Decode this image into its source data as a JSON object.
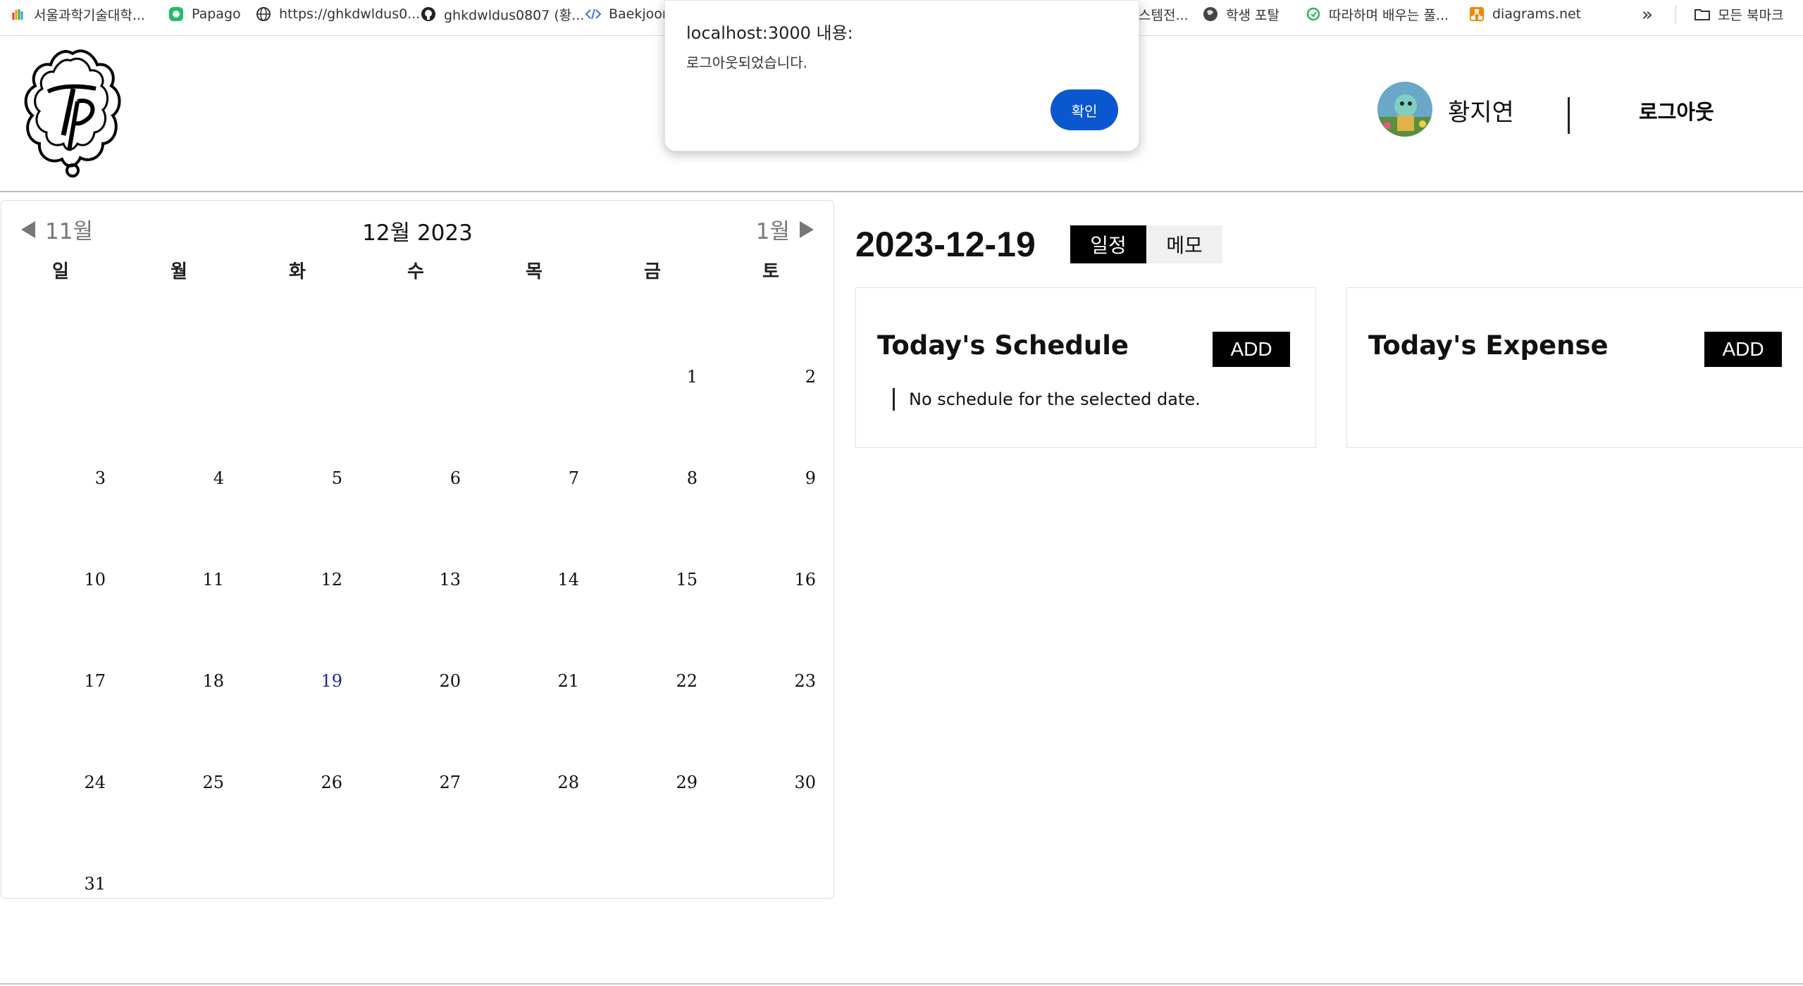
{
  "bookmarks": [
    {
      "label": "서울과학기술대학...",
      "icon": "rainbow-hand-icon"
    },
    {
      "label": "Papago",
      "icon": "papago-icon"
    },
    {
      "label": "https://ghkdwldus0...",
      "icon": "globe-icon"
    },
    {
      "label": "ghkdwldus0807 (황...",
      "icon": "github-icon"
    },
    {
      "label": "Baekjoon",
      "icon": "code-icon"
    },
    {
      "label": "스템전...",
      "icon": ""
    },
    {
      "label": "학생 포탈",
      "icon": "globe-dark-icon"
    },
    {
      "label": "따라하며 배우는 풀...",
      "icon": "inflearn-icon"
    },
    {
      "label": "diagrams.net",
      "icon": "diagrams-icon"
    },
    {
      "label": "모든 북마크",
      "icon": "folder-icon"
    }
  ],
  "bookmarks_more": "»",
  "header": {
    "username": "황지연",
    "logout_label": "로그아웃"
  },
  "dialog": {
    "title": "localhost:3000 내용:",
    "message": "로그아웃되었습니다.",
    "ok_label": "확인"
  },
  "calendar": {
    "title": "12월 2023",
    "prev_label": "11월",
    "next_label": "1월",
    "weekdays": [
      "일",
      "월",
      "화",
      "수",
      "목",
      "금",
      "토"
    ],
    "first_weekday_index": 5,
    "days_in_month": 31,
    "selected_day": 19
  },
  "detail": {
    "date": "2023-12-19",
    "tabs": [
      {
        "label": "일정",
        "active": true
      },
      {
        "label": "메모",
        "active": false
      }
    ],
    "schedule": {
      "title": "Today's Schedule",
      "add_label": "ADD",
      "empty_message": "No schedule for the selected date."
    },
    "expense": {
      "title": "Today's Expense",
      "add_label": "ADD"
    }
  },
  "colors": {
    "dialog_button": "#0b57d0",
    "tab_active_bg": "#000000",
    "selected_day_text": "#1a2a9b"
  }
}
